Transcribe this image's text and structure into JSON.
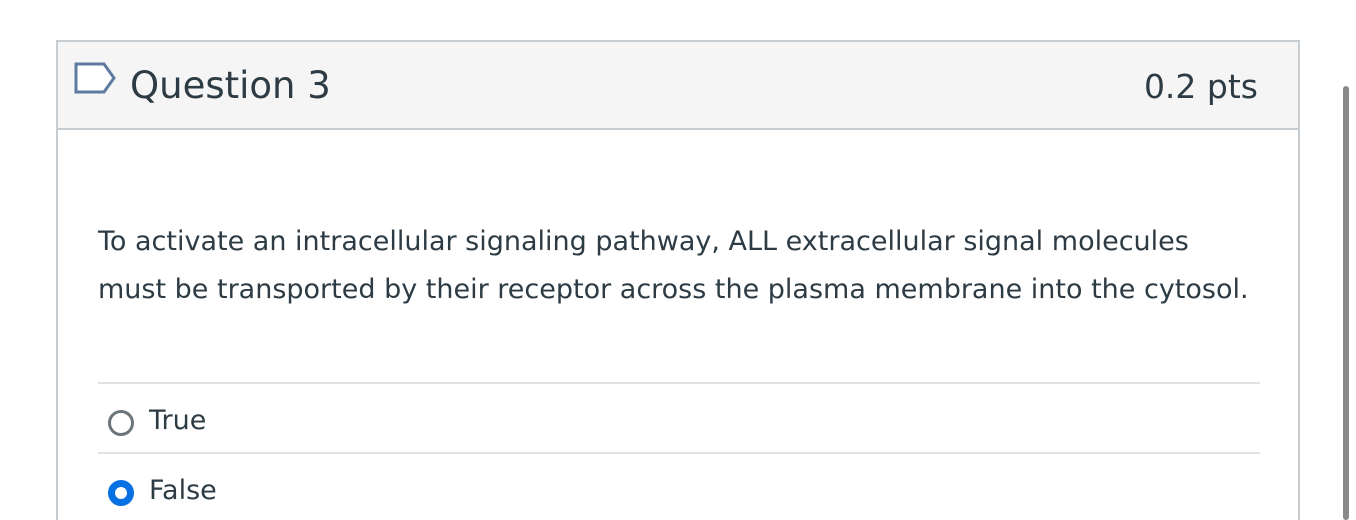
{
  "question": {
    "title": "Question 3",
    "points": "0.2 pts",
    "text": "To activate an intracellular signaling pathway, ALL extracellular signal molecules must be transported by their receptor across the plasma membrane into the cytosol.",
    "answers": [
      {
        "label": "True",
        "selected": false
      },
      {
        "label": "False",
        "selected": true
      }
    ],
    "flag_icon": "flag-outline-icon"
  },
  "colors": {
    "header_background": "#f5f5f5",
    "border": "#c7cdd1",
    "text": "#2d3b45",
    "selected_radio": "#0770e3",
    "flag_outline": "#5d7b9f"
  }
}
